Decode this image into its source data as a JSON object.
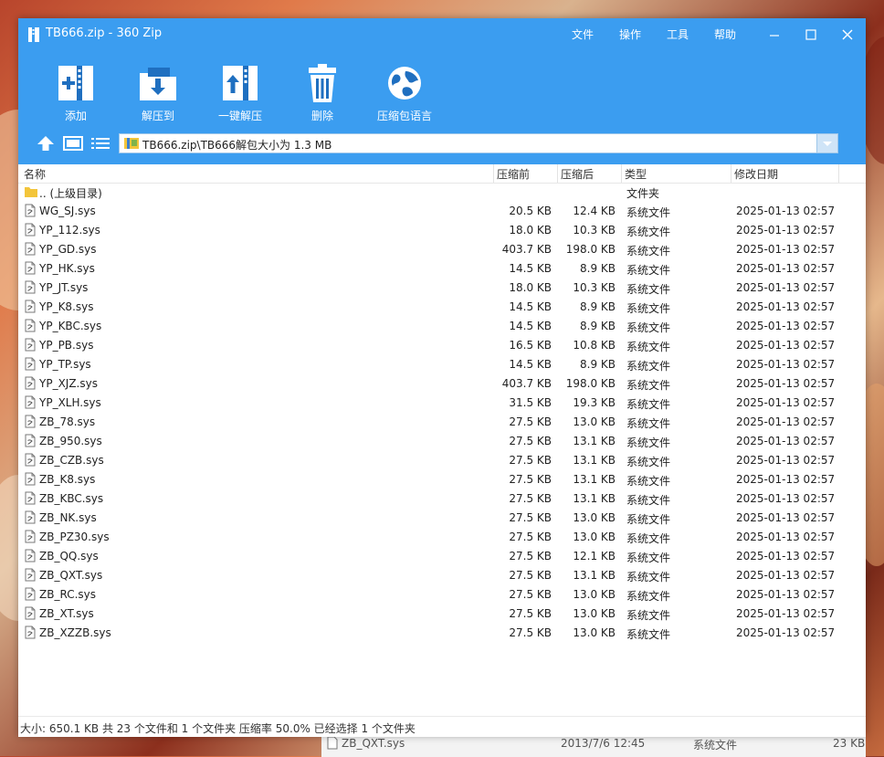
{
  "window": {
    "title": "TB666.zip - 360 Zip",
    "menu": [
      "文件",
      "操作",
      "工具",
      "帮助"
    ],
    "controls": [
      "minimize-icon",
      "maximize-icon",
      "close-icon"
    ]
  },
  "toolbar": {
    "add_label": "添加",
    "extract_label": "解压到",
    "one_click_label": "一键解压",
    "delete_label": "删除",
    "language_label": "压缩包语言"
  },
  "address": {
    "path": "TB666.zip\\TB666解包大小为 1.3 MB"
  },
  "columns": {
    "name": "名称",
    "compressed": "压缩前",
    "original": "压缩后",
    "type": "类型",
    "modified": "修改日期"
  },
  "parent_row": {
    "name": ".. (上级目录)",
    "type": "文件夹"
  },
  "files": [
    {
      "name": "WG_SJ.sys",
      "csize": "20.5 KB",
      "osize": "12.4 KB",
      "type": "系统文件",
      "date": "2025-01-13 02:57"
    },
    {
      "name": "YP_112.sys",
      "csize": "18.0 KB",
      "osize": "10.3 KB",
      "type": "系统文件",
      "date": "2025-01-13 02:57"
    },
    {
      "name": "YP_GD.sys",
      "csize": "403.7 KB",
      "osize": "198.0 KB",
      "type": "系统文件",
      "date": "2025-01-13 02:57"
    },
    {
      "name": "YP_HK.sys",
      "csize": "14.5 KB",
      "osize": "8.9 KB",
      "type": "系统文件",
      "date": "2025-01-13 02:57"
    },
    {
      "name": "YP_JT.sys",
      "csize": "18.0 KB",
      "osize": "10.3 KB",
      "type": "系统文件",
      "date": "2025-01-13 02:57"
    },
    {
      "name": "YP_K8.sys",
      "csize": "14.5 KB",
      "osize": "8.9 KB",
      "type": "系统文件",
      "date": "2025-01-13 02:57"
    },
    {
      "name": "YP_KBC.sys",
      "csize": "14.5 KB",
      "osize": "8.9 KB",
      "type": "系统文件",
      "date": "2025-01-13 02:57"
    },
    {
      "name": "YP_PB.sys",
      "csize": "16.5 KB",
      "osize": "10.8 KB",
      "type": "系统文件",
      "date": "2025-01-13 02:57"
    },
    {
      "name": "YP_TP.sys",
      "csize": "14.5 KB",
      "osize": "8.9 KB",
      "type": "系统文件",
      "date": "2025-01-13 02:57"
    },
    {
      "name": "YP_XJZ.sys",
      "csize": "403.7 KB",
      "osize": "198.0 KB",
      "type": "系统文件",
      "date": "2025-01-13 02:57"
    },
    {
      "name": "YP_XLH.sys",
      "csize": "31.5 KB",
      "osize": "19.3 KB",
      "type": "系统文件",
      "date": "2025-01-13 02:57"
    },
    {
      "name": "ZB_78.sys",
      "csize": "27.5 KB",
      "osize": "13.0 KB",
      "type": "系统文件",
      "date": "2025-01-13 02:57"
    },
    {
      "name": "ZB_950.sys",
      "csize": "27.5 KB",
      "osize": "13.1 KB",
      "type": "系统文件",
      "date": "2025-01-13 02:57"
    },
    {
      "name": "ZB_CZB.sys",
      "csize": "27.5 KB",
      "osize": "13.1 KB",
      "type": "系统文件",
      "date": "2025-01-13 02:57"
    },
    {
      "name": "ZB_K8.sys",
      "csize": "27.5 KB",
      "osize": "13.1 KB",
      "type": "系统文件",
      "date": "2025-01-13 02:57"
    },
    {
      "name": "ZB_KBC.sys",
      "csize": "27.5 KB",
      "osize": "13.1 KB",
      "type": "系统文件",
      "date": "2025-01-13 02:57"
    },
    {
      "name": "ZB_NK.sys",
      "csize": "27.5 KB",
      "osize": "13.0 KB",
      "type": "系统文件",
      "date": "2025-01-13 02:57"
    },
    {
      "name": "ZB_PZ30.sys",
      "csize": "27.5 KB",
      "osize": "13.0 KB",
      "type": "系统文件",
      "date": "2025-01-13 02:57"
    },
    {
      "name": "ZB_QQ.sys",
      "csize": "27.5 KB",
      "osize": "12.1 KB",
      "type": "系统文件",
      "date": "2025-01-13 02:57"
    },
    {
      "name": "ZB_QXT.sys",
      "csize": "27.5 KB",
      "osize": "13.1 KB",
      "type": "系统文件",
      "date": "2025-01-13 02:57"
    },
    {
      "name": "ZB_RC.sys",
      "csize": "27.5 KB",
      "osize": "13.0 KB",
      "type": "系统文件",
      "date": "2025-01-13 02:57"
    },
    {
      "name": "ZB_XT.sys",
      "csize": "27.5 KB",
      "osize": "13.0 KB",
      "type": "系统文件",
      "date": "2025-01-13 02:57"
    },
    {
      "name": "ZB_XZZB.sys",
      "csize": "27.5 KB",
      "osize": "13.0 KB",
      "type": "系统文件",
      "date": "2025-01-13 02:57"
    }
  ],
  "status": {
    "text": "大小: 650.1 KB 共 23 个文件和 1 个文件夹 压缩率 50.0% 已经选择 1 个文件夹"
  },
  "background_window": {
    "name": "ZB_QXT.sys",
    "date": "2013/7/6 12:45",
    "type": "系统文件",
    "size": "23 KB"
  },
  "colors": {
    "header_blue": "#3b9df0",
    "folder_yellow": "#f3c53a"
  }
}
